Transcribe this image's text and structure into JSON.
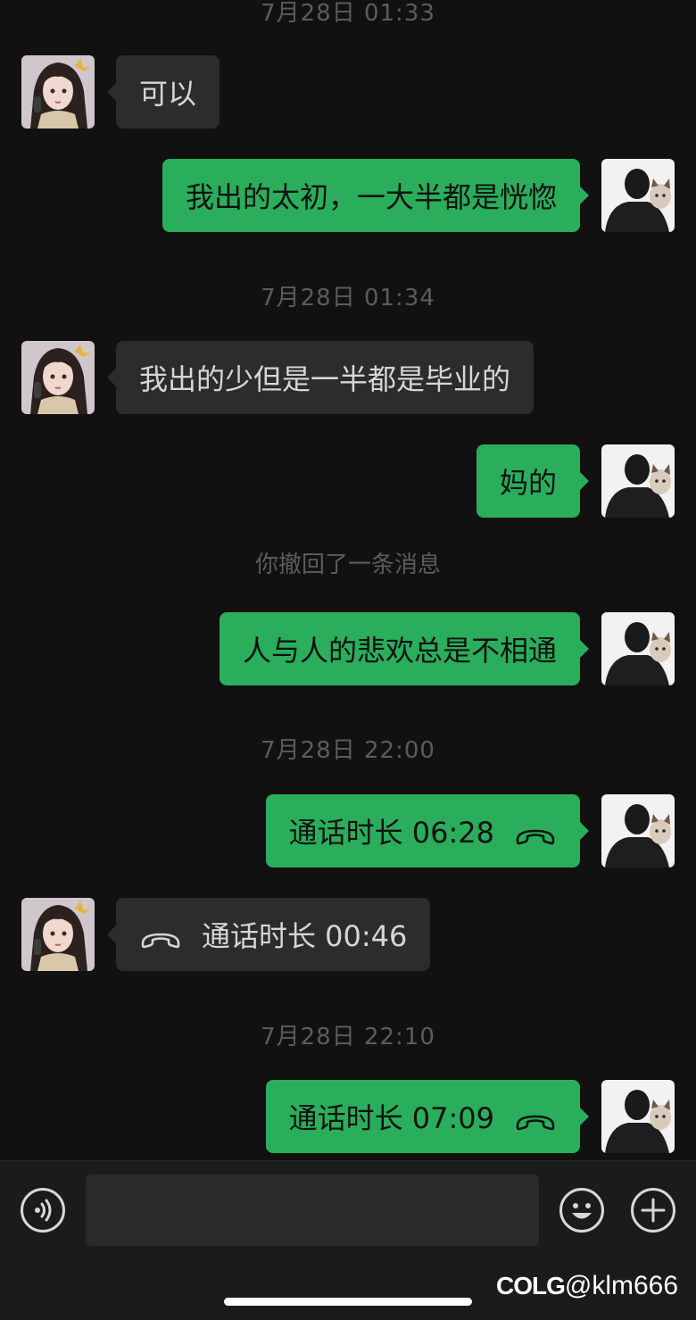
{
  "messages": {
    "ts1": "7月28日 01:33",
    "m1": "可以",
    "m2": "我出的太初，一大半都是恍惚",
    "ts2": "7月28日 01:34",
    "m3": "我出的少但是一半都是毕业的",
    "m4": "妈的",
    "recall_note": "你撤回了一条消息",
    "m5": "人与人的悲欢总是不相通",
    "ts3": "7月28日 22:00",
    "call1": "通话时长 06:28",
    "call2": "通话时长 00:46",
    "ts4": "7月28日 22:10",
    "call3": "通话时长 07:09"
  },
  "input_bar": {
    "voice_icon": "voice-icon",
    "emoji_icon": "emoji-icon",
    "plus_icon": "plus-icon",
    "placeholder": ""
  },
  "watermark": {
    "brand": "COLG",
    "handle": "@klm666"
  },
  "colors": {
    "background": "#111111",
    "outgoing_bubble": "#2aae5b",
    "incoming_bubble": "#2c2c2c",
    "timestamp": "#5c5c5c"
  }
}
